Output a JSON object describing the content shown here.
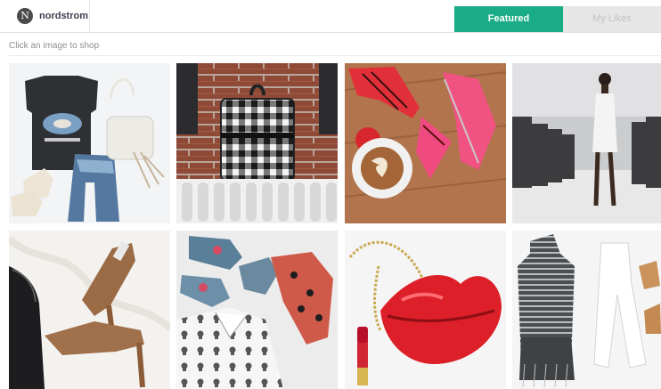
{
  "header": {
    "logo_letter": "N",
    "brand": "nordstrom",
    "tabs": {
      "featured": "Featured",
      "my_likes": "My Likes"
    }
  },
  "instruction": "Click an image to shop",
  "colors": {
    "accent": "#19ac86",
    "inactive_tab": "#e6e6e6"
  },
  "grid": {
    "products": [
      {
        "subject": "graphic tank, denim shorts, white bag, boots"
      },
      {
        "subject": "gingham backpack on radiator"
      },
      {
        "subject": "red and pink heels with latte"
      },
      {
        "subject": "runway model in white dress"
      },
      {
        "subject": "suede pumps with black bag"
      },
      {
        "subject": "embroidered flats and printed shirt"
      },
      {
        "subject": "red lips clutch with lipstick"
      },
      {
        "subject": "knit top, white jeans, tan heels"
      }
    ]
  }
}
